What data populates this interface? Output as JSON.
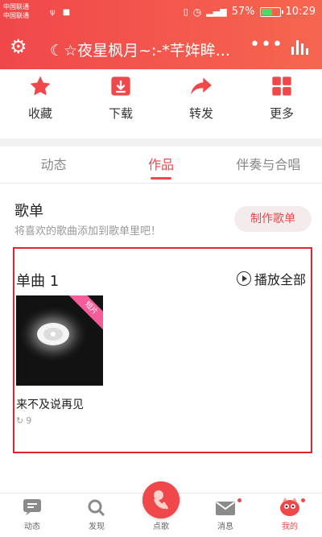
{
  "status_bar": {
    "carrier_1": "中国联通",
    "carrier_2": "中国联通",
    "battery": "57%",
    "time": "10:29",
    "battery_level": 0.57
  },
  "title_bar": {
    "title": "☾☆夜星枫月~:-*芊姩眸..."
  },
  "actions": [
    {
      "label": "收藏",
      "icon": "star-icon"
    },
    {
      "label": "下载",
      "icon": "download-icon"
    },
    {
      "label": "转发",
      "icon": "share-arrow-icon"
    },
    {
      "label": "更多",
      "icon": "grid-icon"
    }
  ],
  "tabs": [
    {
      "label": "动态",
      "active": false
    },
    {
      "label": "作品",
      "active": true
    },
    {
      "label": "伴奏与合唱",
      "active": false
    }
  ],
  "playlist": {
    "title": "歌单",
    "subtitle": "将喜欢的歌曲添加到歌单里吧！",
    "button": "制作歌单"
  },
  "singles": {
    "title": "单曲 1",
    "play_all": "播放全部",
    "songs": [
      {
        "title": "来不及说再见",
        "badge": "短片",
        "plays": "9"
      }
    ]
  },
  "bottom_nav": [
    {
      "label": "动态",
      "icon": "chat-icon",
      "active": false
    },
    {
      "label": "发现",
      "icon": "search-icon",
      "active": false
    },
    {
      "label": "点歌",
      "icon": "sing-icon",
      "active": false
    },
    {
      "label": "消息",
      "icon": "mail-icon",
      "active": false
    },
    {
      "label": "我的",
      "icon": "profile-icon",
      "active": true
    }
  ],
  "colors": {
    "accent": "#f0484a",
    "highlight_box": "#e0242f",
    "badge": "#f45c9a"
  }
}
